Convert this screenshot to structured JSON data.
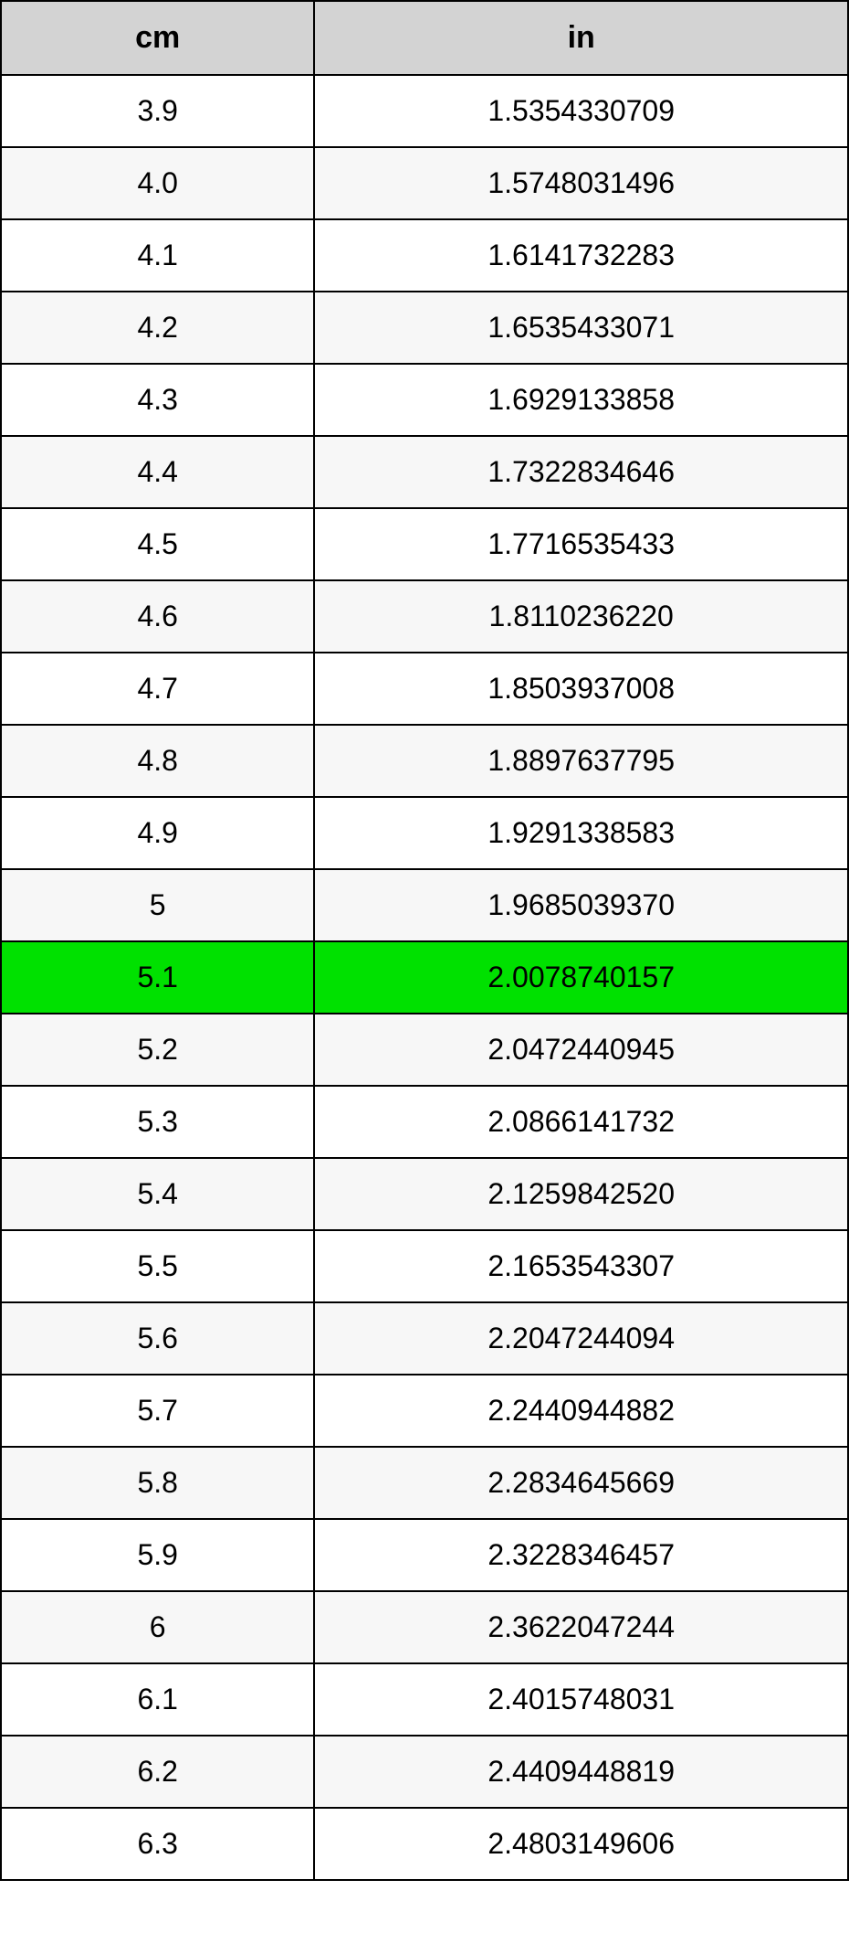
{
  "table": {
    "headers": {
      "col1": "cm",
      "col2": "in"
    },
    "rows": [
      {
        "cm": "3.9",
        "in": "1.5354330709",
        "highlight": false
      },
      {
        "cm": "4.0",
        "in": "1.5748031496",
        "highlight": false
      },
      {
        "cm": "4.1",
        "in": "1.6141732283",
        "highlight": false
      },
      {
        "cm": "4.2",
        "in": "1.6535433071",
        "highlight": false
      },
      {
        "cm": "4.3",
        "in": "1.6929133858",
        "highlight": false
      },
      {
        "cm": "4.4",
        "in": "1.7322834646",
        "highlight": false
      },
      {
        "cm": "4.5",
        "in": "1.7716535433",
        "highlight": false
      },
      {
        "cm": "4.6",
        "in": "1.8110236220",
        "highlight": false
      },
      {
        "cm": "4.7",
        "in": "1.8503937008",
        "highlight": false
      },
      {
        "cm": "4.8",
        "in": "1.8897637795",
        "highlight": false
      },
      {
        "cm": "4.9",
        "in": "1.9291338583",
        "highlight": false
      },
      {
        "cm": "5",
        "in": "1.9685039370",
        "highlight": false
      },
      {
        "cm": "5.1",
        "in": "2.0078740157",
        "highlight": true
      },
      {
        "cm": "5.2",
        "in": "2.0472440945",
        "highlight": false
      },
      {
        "cm": "5.3",
        "in": "2.0866141732",
        "highlight": false
      },
      {
        "cm": "5.4",
        "in": "2.1259842520",
        "highlight": false
      },
      {
        "cm": "5.5",
        "in": "2.1653543307",
        "highlight": false
      },
      {
        "cm": "5.6",
        "in": "2.2047244094",
        "highlight": false
      },
      {
        "cm": "5.7",
        "in": "2.2440944882",
        "highlight": false
      },
      {
        "cm": "5.8",
        "in": "2.2834645669",
        "highlight": false
      },
      {
        "cm": "5.9",
        "in": "2.3228346457",
        "highlight": false
      },
      {
        "cm": "6",
        "in": "2.3622047244",
        "highlight": false
      },
      {
        "cm": "6.1",
        "in": "2.4015748031",
        "highlight": false
      },
      {
        "cm": "6.2",
        "in": "2.4409448819",
        "highlight": false
      },
      {
        "cm": "6.3",
        "in": "2.4803149606",
        "highlight": false
      }
    ]
  }
}
